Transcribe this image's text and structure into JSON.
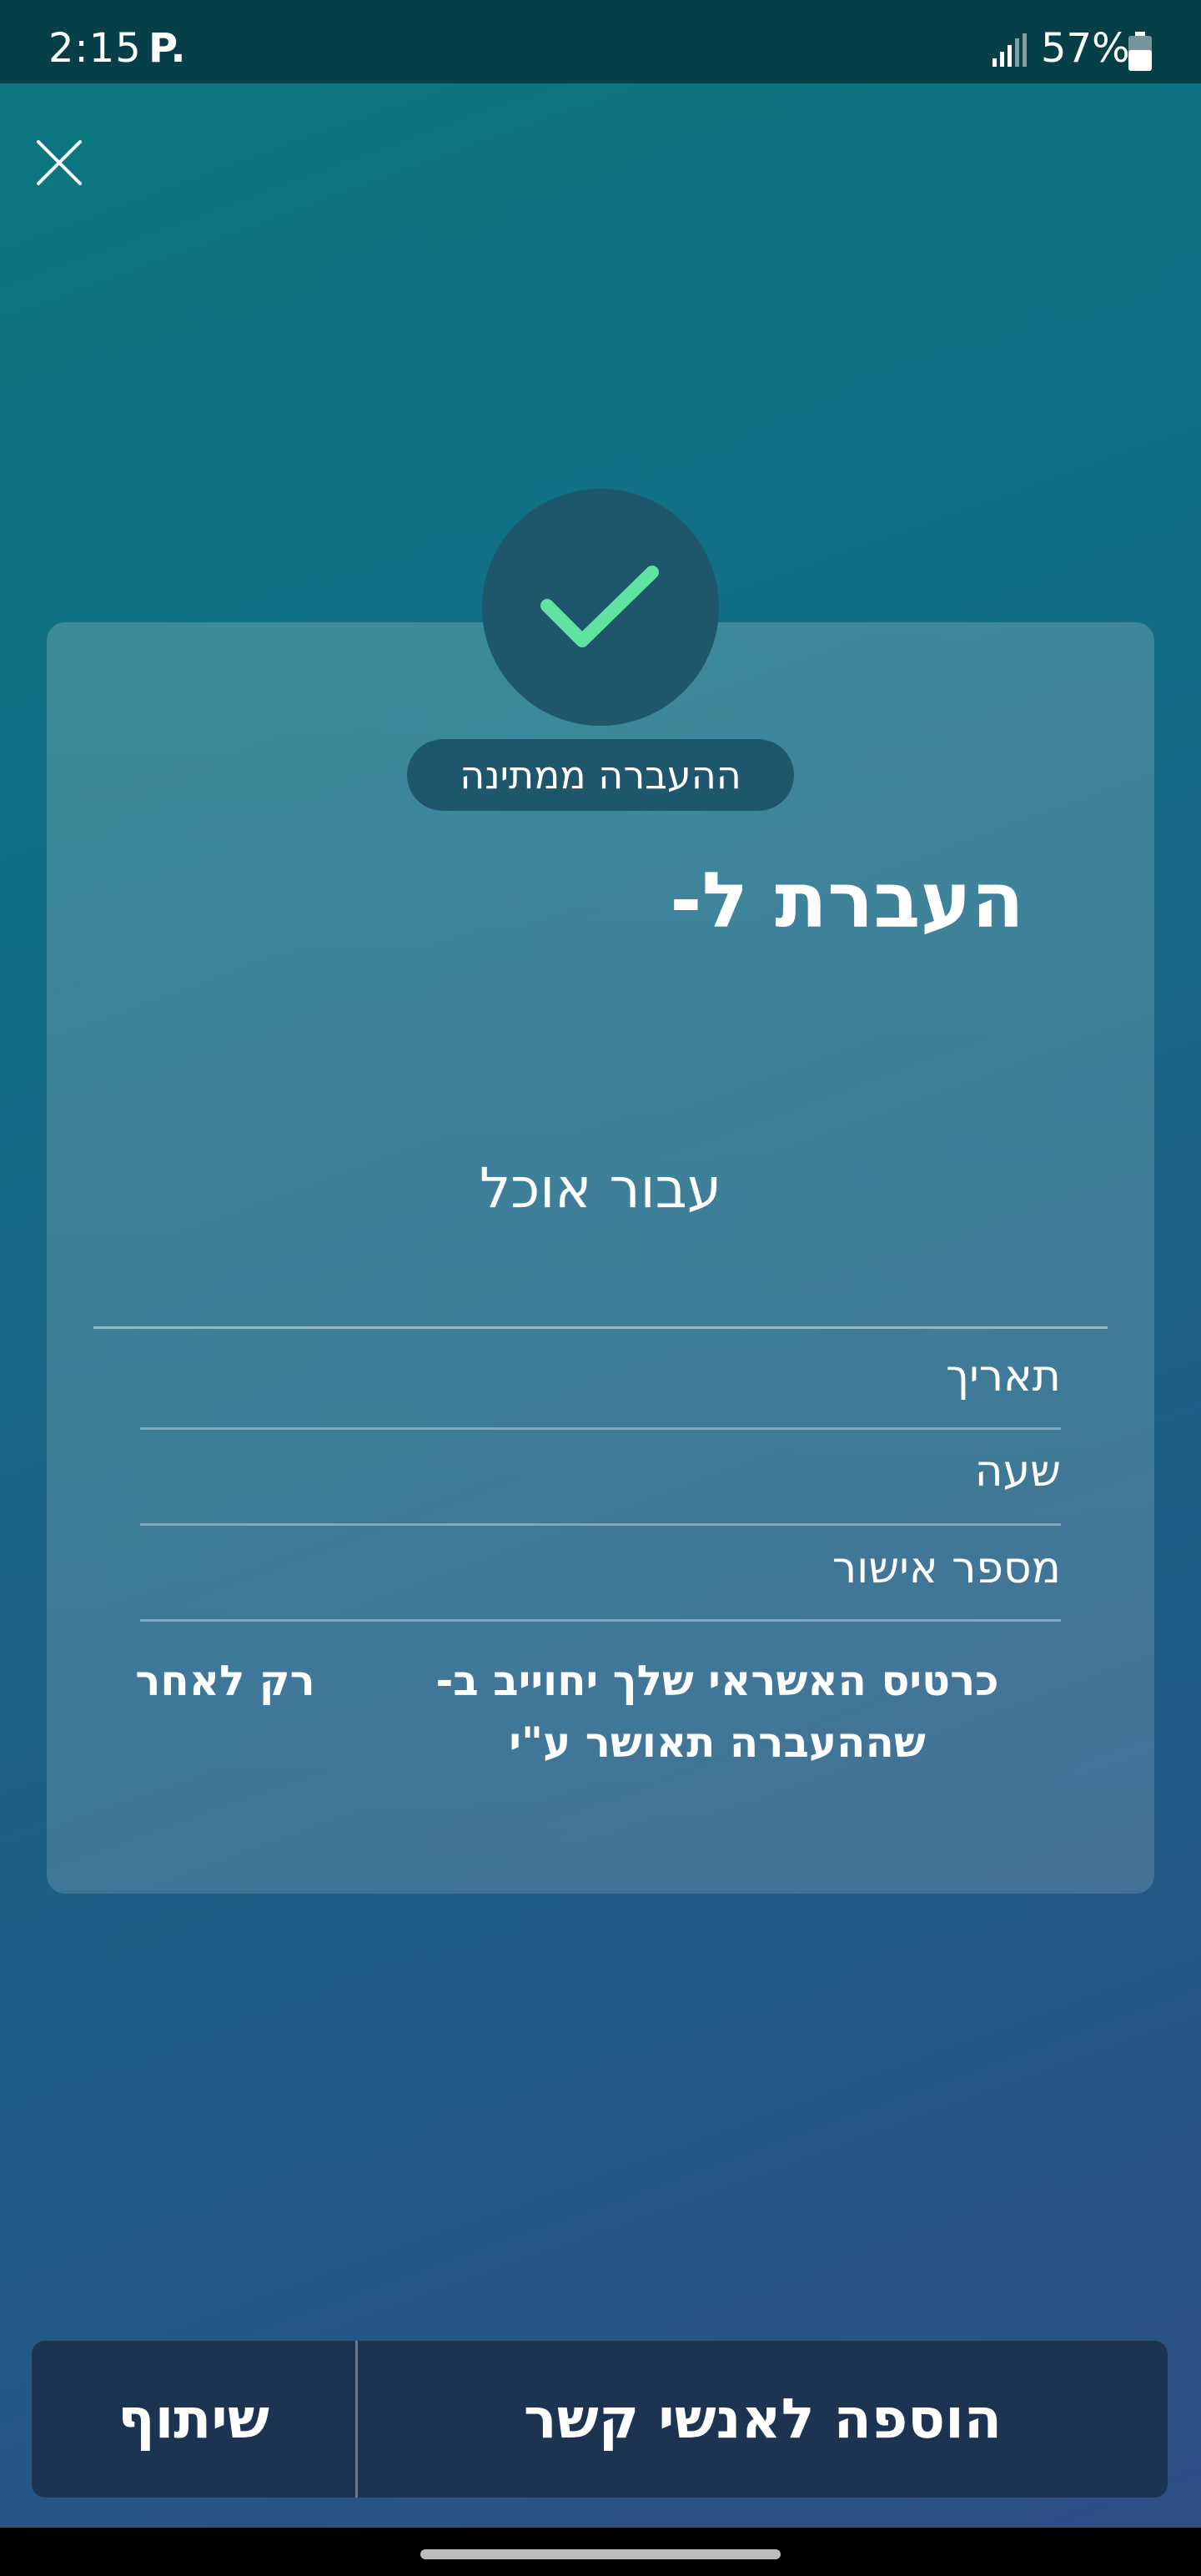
{
  "status_bar": {
    "time": "2:15",
    "notification_icon_label": "P.",
    "battery_percent": "57%",
    "icons": [
      "signal-icon",
      "battery-icon"
    ]
  },
  "header": {
    "close_icon": "close-icon"
  },
  "confirmation": {
    "status_icon": "check-icon",
    "status_badge": "ההעברה ממתינה",
    "title": "העברת ל-",
    "purpose": "עבור אוכל"
  },
  "details": {
    "rows": [
      {
        "label": "תאריך"
      },
      {
        "label": "שעה"
      },
      {
        "label": "מספר אישור"
      }
    ],
    "charge_note_main": "כרטיס האשראי שלך יחוייב ב- שההעברה תאושר ע\"י",
    "charge_note_side": "רק לאחר"
  },
  "actions": {
    "add_contacts_label": "הוספה לאנשי קשר",
    "share_label": "שיתוף"
  },
  "colors": {
    "check_accent": "#5fe3a1",
    "circle_bg": "#1e566c",
    "bottom_bar_bg": "#1c3452"
  }
}
